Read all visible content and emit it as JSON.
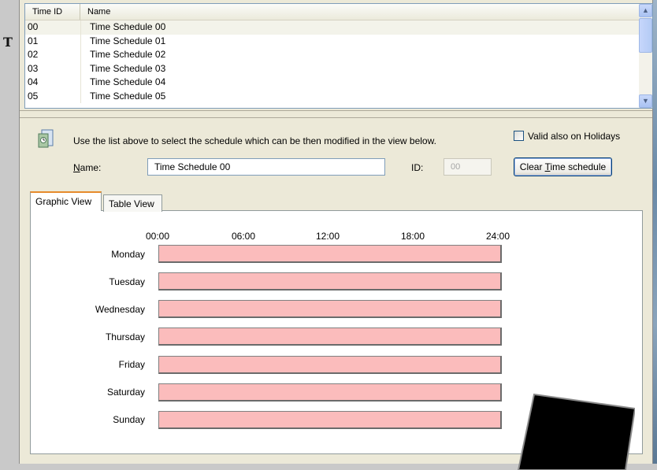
{
  "background": {
    "left_letter": "T"
  },
  "list": {
    "columns": [
      "Time ID",
      "Name"
    ],
    "rows": [
      {
        "id": "00",
        "name": "Time Schedule 00",
        "selected": true
      },
      {
        "id": "01",
        "name": "Time Schedule 01"
      },
      {
        "id": "02",
        "name": "Time Schedule 02"
      },
      {
        "id": "03",
        "name": "Time Schedule 03"
      },
      {
        "id": "04",
        "name": "Time Schedule 04"
      },
      {
        "id": "05",
        "name": "Time Schedule 05"
      }
    ]
  },
  "details": {
    "info_text": "Use the list above to select the schedule which can be then modified in the view below.",
    "holiday_label": "Valid also on Holidays",
    "holiday_checked": false,
    "name_label_accel": "N",
    "name_label_rest": "ame:",
    "name_value": "Time Schedule 00",
    "id_label": "ID:",
    "id_value": "00",
    "clear_button_pre": "Clear ",
    "clear_button_accel": "T",
    "clear_button_post": "ime schedule"
  },
  "tabs": [
    "Graphic View",
    "Table View"
  ],
  "active_tab": "Graphic View",
  "graphic": {
    "hours": [
      "00:00",
      "06:00",
      "12:00",
      "18:00",
      "24:00"
    ],
    "days": [
      "Monday",
      "Tuesday",
      "Wednesday",
      "Thursday",
      "Friday",
      "Saturday",
      "Sunday"
    ]
  },
  "colors": {
    "day_bar_fill": "#fbbcbc",
    "tab_highlight": "#e68b2c",
    "window_bg": "#ece9d8"
  }
}
